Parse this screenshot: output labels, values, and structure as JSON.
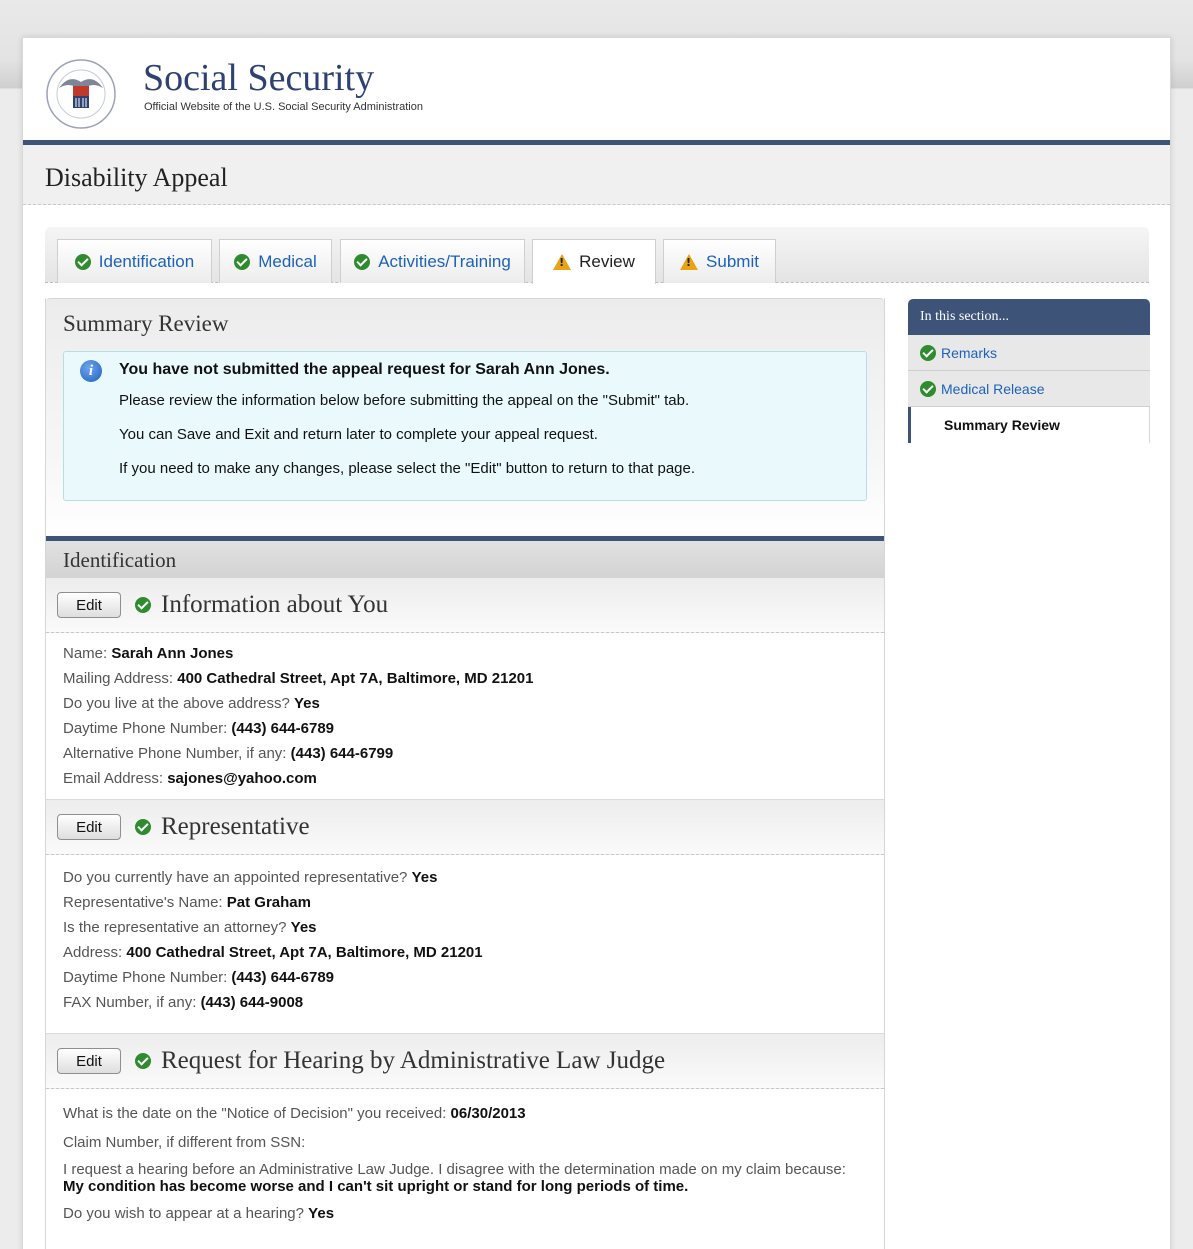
{
  "header": {
    "title": "Social Security",
    "subtitle": "Official Website of the U.S. Social Security Administration",
    "seal_text": "SOCIAL SECURITY ADMINISTRATION USA"
  },
  "page_title": "Disability Appeal",
  "tabs": [
    {
      "label": "Identification",
      "status": "complete"
    },
    {
      "label": "Medical",
      "status": "complete"
    },
    {
      "label": "Activities/Training",
      "status": "complete"
    },
    {
      "label": "Review",
      "status": "warning",
      "active": true
    },
    {
      "label": "Submit",
      "status": "warning"
    }
  ],
  "summary": {
    "heading": "Summary Review",
    "notice_title": "You have not submitted the appeal request for Sarah Ann Jones.",
    "notice_lines": [
      "Please review the information below before submitting the appeal on the \"Submit\" tab.",
      "You can Save and Exit and return later to complete your appeal request.",
      "If you need to make any changes, please select the \"Edit\" button to return to that page."
    ]
  },
  "identification": {
    "heading": "Identification",
    "edit_label": "Edit",
    "about_you": {
      "title": "Information about You",
      "rows": [
        {
          "label": "Name:",
          "value": "Sarah Ann Jones"
        },
        {
          "label": "Mailing Address:",
          "value": "400 Cathedral Street, Apt 7A, Baltimore, MD 21201"
        },
        {
          "label": "Do you live at the above address?",
          "value": "Yes"
        },
        {
          "label": "Daytime Phone Number:",
          "value": "(443) 644-6789"
        },
        {
          "label": "Alternative Phone Number, if any:",
          "value": "(443) 644-6799"
        },
        {
          "label": "Email Address:",
          "value": "sajones@yahoo.com"
        }
      ]
    },
    "representative": {
      "title": "Representative",
      "rows": [
        {
          "label": "Do you currently have an appointed representative?",
          "value": "Yes"
        },
        {
          "label": "Representative's Name:",
          "value": "Pat Graham"
        },
        {
          "label": "Is the representative an attorney?",
          "value": "Yes"
        },
        {
          "label": "Address:",
          "value": "400 Cathedral Street, Apt 7A, Baltimore, MD 21201"
        },
        {
          "label": "Daytime Phone Number:",
          "value": "(443) 644-6789"
        },
        {
          "label": "FAX Number, if any:",
          "value": "(443) 644-9008"
        }
      ]
    },
    "hearing": {
      "title": "Request for Hearing by Administrative Law Judge",
      "rows": [
        {
          "label": "What is the date on the \"Notice of Decision\" you received:",
          "value": "06/30/2013"
        },
        {
          "label": "Claim Number, if different from SSN:",
          "value": ""
        },
        {
          "label": "I request a hearing before an Administrative Law Judge. I disagree with the determination made on my claim because:",
          "value": "My condition has become worse and I can't sit upright or stand for long periods of time."
        },
        {
          "label": "Do you wish to appear at a hearing?",
          "value": "Yes"
        }
      ]
    }
  },
  "sidebar": {
    "heading": "In this section...",
    "items": [
      {
        "label": "Remarks",
        "status": "complete"
      },
      {
        "label": "Medical Release",
        "status": "complete"
      },
      {
        "label": "Summary Review",
        "current": true
      }
    ]
  },
  "colors": {
    "brand_navy": "#3e5378",
    "link_blue": "#1c62b9",
    "ok_green": "#2e8b2e",
    "warn_amber": "#e8a317",
    "info_bg": "#eafafc"
  }
}
